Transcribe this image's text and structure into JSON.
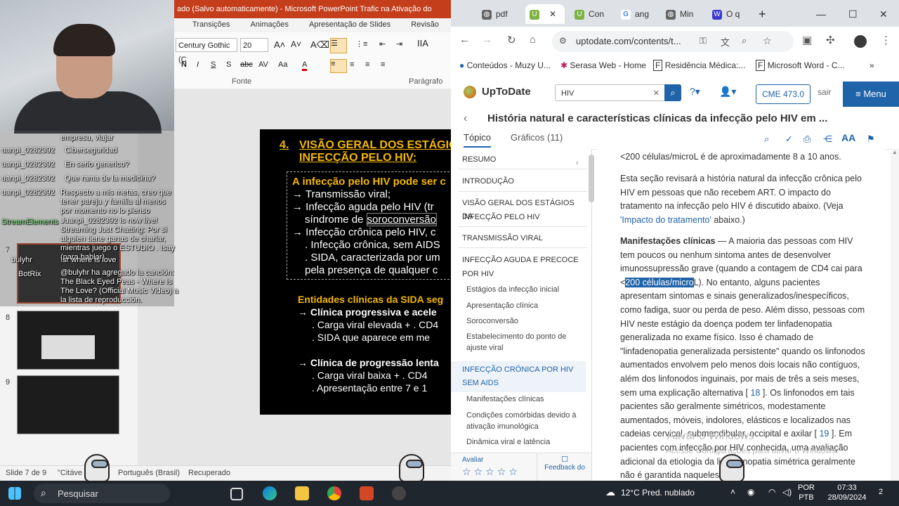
{
  "powerpoint": {
    "window_title": "ado (Salvo automaticamente) - Microsoft PowerPoint Trafic na Ativação do",
    "tabs": [
      "Transições",
      "Animações",
      "Apresentação de Slides",
      "Revisão",
      "Ex"
    ],
    "font_name": "Century Gothic (C",
    "font_size": "20",
    "group_font": "Fonte",
    "group_paragraph": "Parágrafo",
    "status": {
      "slide": "Slide 7 de 9",
      "theme": "\"Citáve",
      "language": "Português (Brasil)",
      "saved": "Recuperado"
    },
    "thumbnails": [
      {
        "num": "7"
      },
      {
        "num": "8"
      },
      {
        "num": "9"
      }
    ],
    "slide": {
      "heading_num": "4.",
      "heading_1": "VISÃO GERAL DOS ESTÁGIO",
      "heading_2": "INFECÇÃO PELO HIV:",
      "subtitle": "A infecção pelo HIV pode ser c",
      "b1": "→ Transmissão viral;",
      "b2": "→ Infecção aguda pelo HIV (tr",
      "b2b_pre": "síndrome de ",
      "b2b_link": "soroconversão",
      "b3": "→ Infecção crônica pelo HIV, c",
      "b3a": ". Infecção crônica, sem AIDS",
      "b3b": ". SIDA, caracterizada por um",
      "b3c": "pela presença de qualquer c",
      "entities": "Entidades clínicas da SIDA seg",
      "c1": "→ Clínica progressiva  e acele",
      "c1a": ". Carga viral elevada + . CD4",
      "c1b": ". SIDA que aparece  em me",
      "c2": "→ Clínica de progressão lenta",
      "c2a": ". Carga viral baixa + . CD4",
      "c2b": ". Apresentação entre 7 e 1"
    }
  },
  "chat": [
    {
      "user": "",
      "text": "empresa, viajar"
    },
    {
      "user": "uanpi_0282392",
      "text": "Ciberseguridad"
    },
    {
      "user": "uanpi_0282392",
      "text": "En serio generico?"
    },
    {
      "user": "uanpi_0282392",
      "text": "Que rama de la medicina?"
    },
    {
      "user": "uanpi_0282392",
      "text": "Respecto a mis metas, creo que tener pareja y familia al menos por momento no lo pienso"
    },
    {
      "user": "StreamElements",
      "text": "Juanpi_0282392 is now live! Streaming Just Chatting: Por si alguien tiene ganas de charlar, mientras juego o ESTUDIO . Isay (para hablar)"
    },
    {
      "user": "bulyhr",
      "text": "!sr where is love"
    },
    {
      "user": "BotRix",
      "text": "@bulyhr ha agregado la canción: The Black Eyed Peas - Where Is The Love? (Official Music Video) a la lista de reproducción."
    }
  ],
  "browser": {
    "tabs": [
      {
        "label": "pdf"
      },
      {
        "label": ""
      },
      {
        "label": "Con"
      },
      {
        "label": "ang"
      },
      {
        "label": "Min"
      },
      {
        "label": "O q"
      }
    ],
    "url": "uptodate.com/contents/t...",
    "bookmarks": [
      "Conteúdos - Muzy U...",
      "Serasa Web - Home",
      "Residência Médica:...",
      "Microsoft Word - C..."
    ],
    "utd": {
      "brand": "UpToDate",
      "search_value": "HIV",
      "cme": "CME 473.0",
      "sair": "sair",
      "menu": "Menu",
      "topic_title": "História natural e características clínicas da infecção pelo HIV em ...",
      "tab_topic": "Tópico",
      "tab_graphics": "Gráficos (11)"
    },
    "toc": [
      {
        "label": "RESUMO",
        "type": "main"
      },
      {
        "label": "INTRODUÇÃO",
        "type": "main"
      },
      {
        "label": "VISÃO GERAL DOS ESTÁGIOS DA",
        "type": "main"
      },
      {
        "label": "INFECÇÃO PELO HIV",
        "type": "cont"
      },
      {
        "label": "TRANSMISSÃO VIRAL",
        "type": "main"
      },
      {
        "label": "INFECÇÃO AGUDA E PRECOCE",
        "type": "main"
      },
      {
        "label": "POR HIV",
        "type": "cont"
      },
      {
        "label": "Estágios da infecção inicial",
        "type": "sub"
      },
      {
        "label": "Apresentação clínica",
        "type": "sub"
      },
      {
        "label": "Soroconversão",
        "type": "sub"
      },
      {
        "label": "Estabelecimento do ponto de",
        "type": "sub"
      },
      {
        "label": "ajuste viral",
        "type": "subcont"
      },
      {
        "label": "INFECÇÃO CRÔNICA POR HIV",
        "type": "hl"
      },
      {
        "label": "SEM AIDS",
        "type": "hlcont"
      },
      {
        "label": "Manifestações clínicas",
        "type": "sub"
      },
      {
        "label": "Condições comórbidas devido à",
        "type": "sub"
      },
      {
        "label": "ativação imunológica",
        "type": "subcont"
      },
      {
        "label": "Dinâmica viral e latência",
        "type": "sub"
      }
    ],
    "rate_label": "Avaliar",
    "feedback": "Feedback do",
    "article": {
      "p1": "<200 células/microL é de aproximadamente 8 a 10 anos.",
      "p2": "Esta seção revisará a história natural da infecção crônica pelo HIV em pessoas que não recebem ART. O impacto do tratamento na infecção pelo HIV é discutido abaixo. (Veja",
      "p2_link": "'Impacto do tratamento'",
      "p2_end": " abaixo.)",
      "p3_title": "Manifestações clínicas",
      "p3_a": " — A maioria das pessoas com HIV tem poucos ou nenhum sintoma antes de desenvolver imunossupressão grave (quando a contagem de CD4 cai para <",
      "p3_sel": "200 células/micro",
      "p3_b": "L). No entanto, alguns pacientes apresentam sintomas e sinais generalizados/inespecíficos, como fadiga, suor ou perda de peso. Além disso, pessoas com HIV neste estágio da doença podem ter linfadenopatia generalizada no exame físico. Isso é chamado de \"linfadenopatia generalizada persistente\" quando os linfonodos aumentados envolvem pelo menos dois locais não contíguos, além dos linfonodos inguinais, por mais de três a seis meses, sem uma explicação alternativa [",
      "ref1": " 18 ",
      "p3_c": "]. Os linfonodos em tais pacientes são geralmente simétricos, modestamente aumentados, móveis, indolores, elásticos e localizados nas cadeias cervical, submandibular, occipital e axilar [",
      "ref2": " 19 ",
      "p3_d": "]. Em pacientes com infecção por HIV conhecida, uma avaliação adicional da etiologia da linfadenopatia simétrica geralmente não é garantida naqueles sem"
    },
    "watermark_1": "Ativar o Windows",
    "watermark_2": "Acesse Configurações para ativar o Windows."
  },
  "taskbar": {
    "search": "Pesquisar",
    "weather": "12°C  Pred. nublado",
    "lang_1": "POR",
    "lang_2": "PTB",
    "time": "07:33",
    "date": "28/09/2024",
    "notif": "2"
  }
}
